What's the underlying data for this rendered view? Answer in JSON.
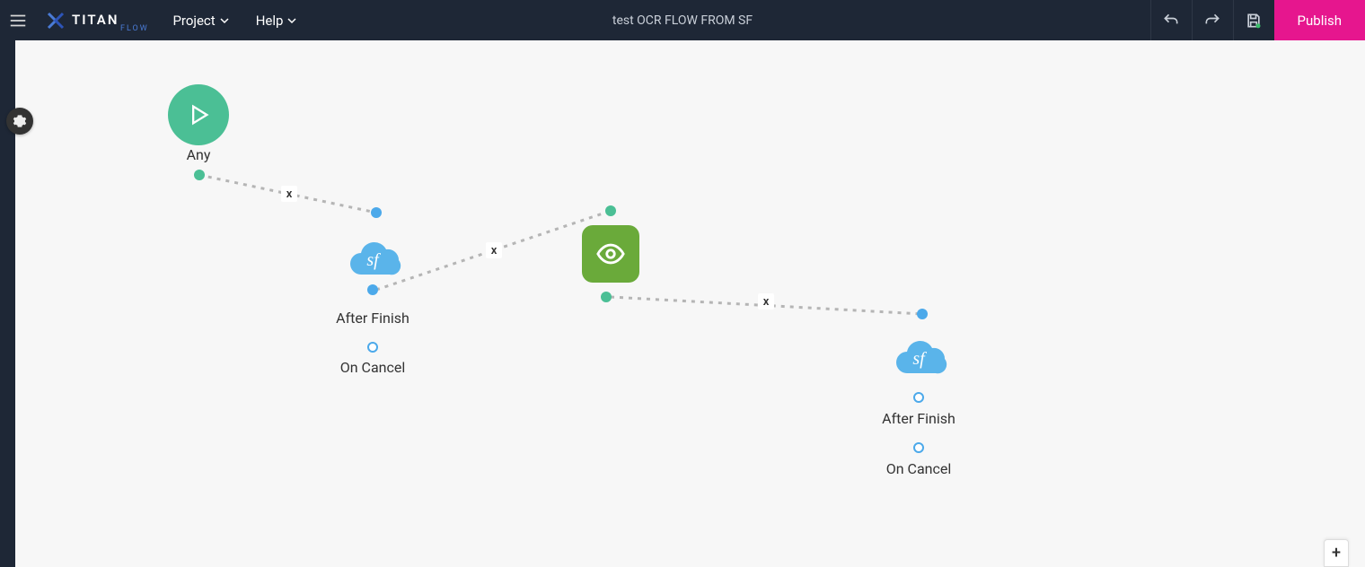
{
  "header": {
    "logo_title": "TITAN",
    "logo_sub": "FLOW",
    "menu": {
      "project": "Project",
      "help": "Help"
    },
    "doc_title": "test OCR FLOW FROM SF",
    "publish": "Publish"
  },
  "nodes": {
    "start_label": "Any",
    "sf1_after": "After Finish",
    "sf1_cancel": "On Cancel",
    "sf2_after": "After Finish",
    "sf2_cancel": "On Cancel",
    "sf_glyph": "sf"
  },
  "edges": {
    "x": "x"
  },
  "zoom": {
    "plus": "+"
  }
}
